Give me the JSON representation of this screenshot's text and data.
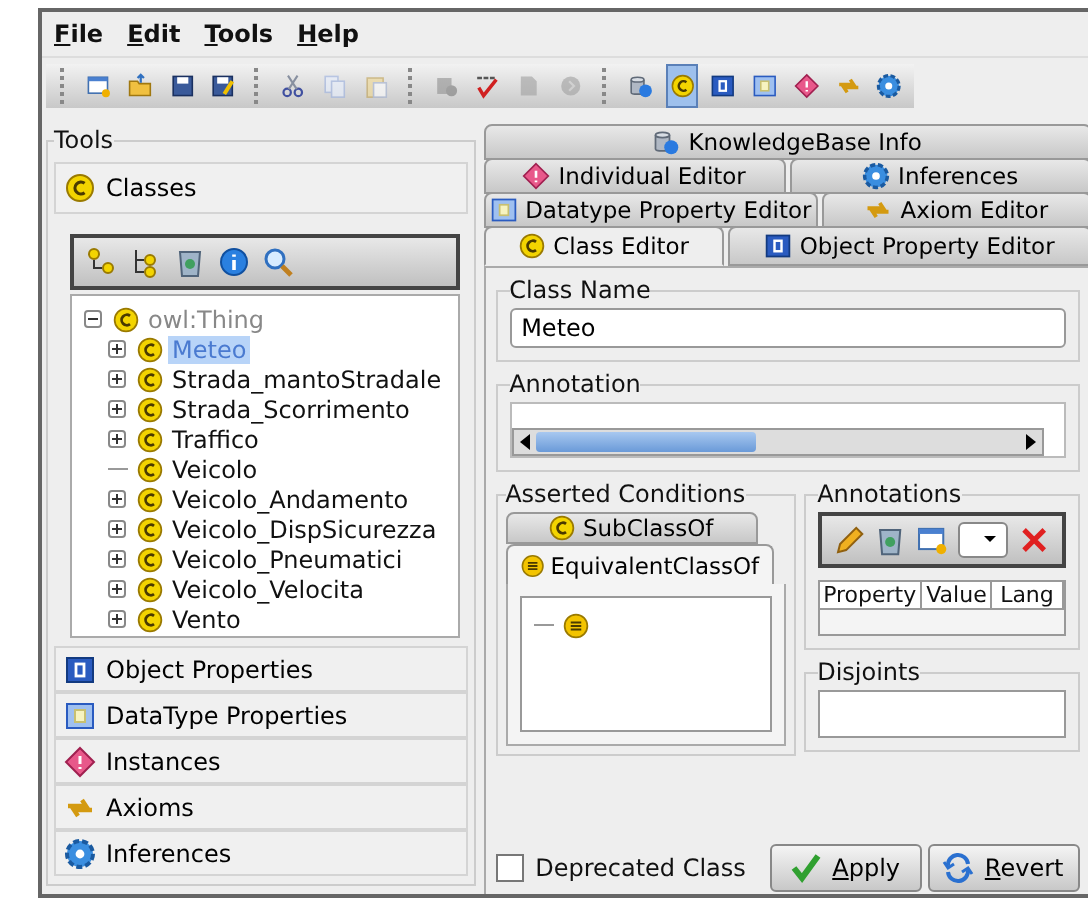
{
  "menu": [
    "File",
    "Edit",
    "Tools",
    "Help"
  ],
  "toolbar": [
    [
      {
        "kind": "new",
        "disabled": false,
        "selected": false
      },
      {
        "kind": "open",
        "disabled": false,
        "selected": false
      },
      {
        "kind": "save",
        "disabled": false,
        "selected": false
      },
      {
        "kind": "save-as",
        "disabled": false,
        "selected": false
      }
    ],
    [
      {
        "kind": "cut",
        "disabled": false,
        "selected": false
      },
      {
        "kind": "copy",
        "disabled": true,
        "selected": false
      },
      {
        "kind": "paste",
        "disabled": true,
        "selected": false
      }
    ],
    [
      {
        "kind": "shape",
        "disabled": true,
        "selected": false
      },
      {
        "kind": "spellcheck",
        "disabled": false,
        "selected": false
      },
      {
        "kind": "document",
        "disabled": true,
        "selected": false
      },
      {
        "kind": "circle",
        "disabled": true,
        "selected": false
      }
    ],
    [
      {
        "kind": "database",
        "disabled": false,
        "selected": false
      },
      {
        "kind": "class",
        "disabled": false,
        "selected": true
      },
      {
        "kind": "objprop",
        "disabled": false,
        "selected": false
      },
      {
        "kind": "datatype",
        "disabled": false,
        "selected": false
      },
      {
        "kind": "individual",
        "disabled": false,
        "selected": false
      },
      {
        "kind": "axiom",
        "disabled": false,
        "selected": false
      },
      {
        "kind": "inference",
        "disabled": false,
        "selected": false
      }
    ]
  ],
  "tools": {
    "title": "Tools",
    "sections": [
      {
        "label": "Classes",
        "kind": "class",
        "expanded": true
      },
      {
        "label": "Object Properties",
        "kind": "objprop",
        "expanded": false
      },
      {
        "label": "DataType Properties",
        "kind": "datatype",
        "expanded": false
      },
      {
        "label": "Instances",
        "kind": "individual",
        "expanded": false
      },
      {
        "label": "Axioms",
        "kind": "axiom",
        "expanded": false
      },
      {
        "label": "Inferences",
        "kind": "inference",
        "expanded": false
      }
    ],
    "tree": [
      {
        "label": "owl:Thing",
        "expanded": true,
        "selected": false,
        "children": [
          {
            "label": "Meteo",
            "expandable": true,
            "selected": true
          },
          {
            "label": "Strada_mantoStradale",
            "expandable": true,
            "selected": false
          },
          {
            "label": "Strada_Scorrimento",
            "expandable": true,
            "selected": false
          },
          {
            "label": "Traffico",
            "expandable": true,
            "selected": false
          },
          {
            "label": "Veicolo",
            "expandable": false,
            "selected": false
          },
          {
            "label": "Veicolo_Andamento",
            "expandable": true,
            "selected": false
          },
          {
            "label": "Veicolo_DispSicurezza",
            "expandable": true,
            "selected": false
          },
          {
            "label": "Veicolo_Pneumatici",
            "expandable": true,
            "selected": false
          },
          {
            "label": "Veicolo_Velocita",
            "expandable": true,
            "selected": false
          },
          {
            "label": "Vento",
            "expandable": true,
            "selected": false
          }
        ]
      }
    ]
  },
  "tabs": [
    [
      {
        "label": "KnowledgeBase Info",
        "kind": "database",
        "selected": false
      }
    ],
    [
      {
        "label": "Individual Editor",
        "kind": "individual",
        "selected": false
      },
      {
        "label": "Inferences",
        "kind": "inference",
        "selected": false
      }
    ],
    [
      {
        "label": "Datatype Property Editor",
        "kind": "datatype",
        "selected": false
      },
      {
        "label": "Axiom Editor",
        "kind": "axiom",
        "selected": false
      }
    ],
    [
      {
        "label": "Class Editor",
        "kind": "class",
        "selected": true
      },
      {
        "label": "Object Property Editor",
        "kind": "objprop",
        "selected": false
      }
    ]
  ],
  "class_name": {
    "title": "Class Name",
    "value": "Meteo"
  },
  "annotation": {
    "title": "Annotation"
  },
  "asserted_conditions": {
    "title": "Asserted Conditions",
    "tabs": [
      {
        "label": "SubClassOf",
        "kind": "class",
        "selected": false
      },
      {
        "label": "EquivalentClassOf",
        "kind": "equivalent",
        "selected": true
      }
    ]
  },
  "annotations": {
    "title": "Annotations",
    "columns": [
      "Property",
      "Value",
      "Lang"
    ]
  },
  "disjoints": {
    "title": "Disjoints"
  },
  "deprecated": {
    "label": "Deprecated Class",
    "checked": false
  },
  "buttons": [
    {
      "label": "Apply",
      "kind": "apply"
    },
    {
      "label": "Revert",
      "kind": "revert"
    }
  ]
}
